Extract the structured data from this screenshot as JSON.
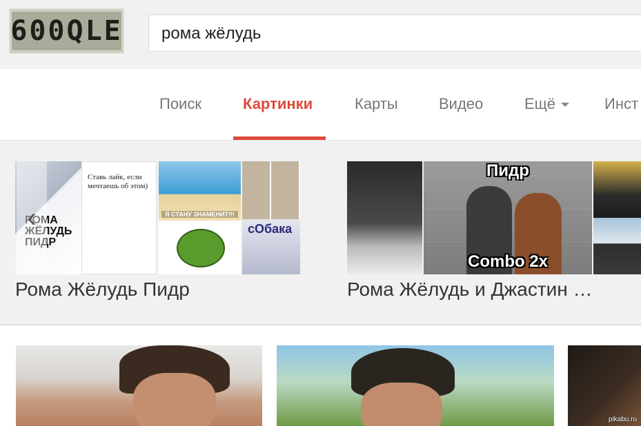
{
  "header": {
    "logo_text": "600QLE",
    "search_query": "рома жёлудь"
  },
  "tabs": [
    {
      "label": "Поиск",
      "active": false
    },
    {
      "label": "Картинки",
      "active": true
    },
    {
      "label": "Карты",
      "active": false
    },
    {
      "label": "Видео",
      "active": false
    },
    {
      "label": "Ещё",
      "active": false
    },
    {
      "label": "Инст",
      "active": false
    }
  ],
  "collections": [
    {
      "title": "Рома Жёлудь Пидр",
      "tile_texts": {
        "tshirt_print": "РОМА ЖЁЛУДЬ ПИДР",
        "quote": "Ставь лайк, если мечтаешь об этом)",
        "meme_caption": "Я СТАНУ ЗНАМЕНИТ!!!",
        "magazine_name": "сОбака"
      }
    },
    {
      "title": "Рома Жёлудь и Джастин …",
      "tile_texts": {
        "caption_top": "Пидр",
        "caption_bottom": "Combo 2x"
      }
    }
  ],
  "watermark": "pikabu.ru",
  "colors": {
    "accent": "#dd4b39",
    "header_bg": "#f1f1f1",
    "tab_text": "#777777"
  }
}
